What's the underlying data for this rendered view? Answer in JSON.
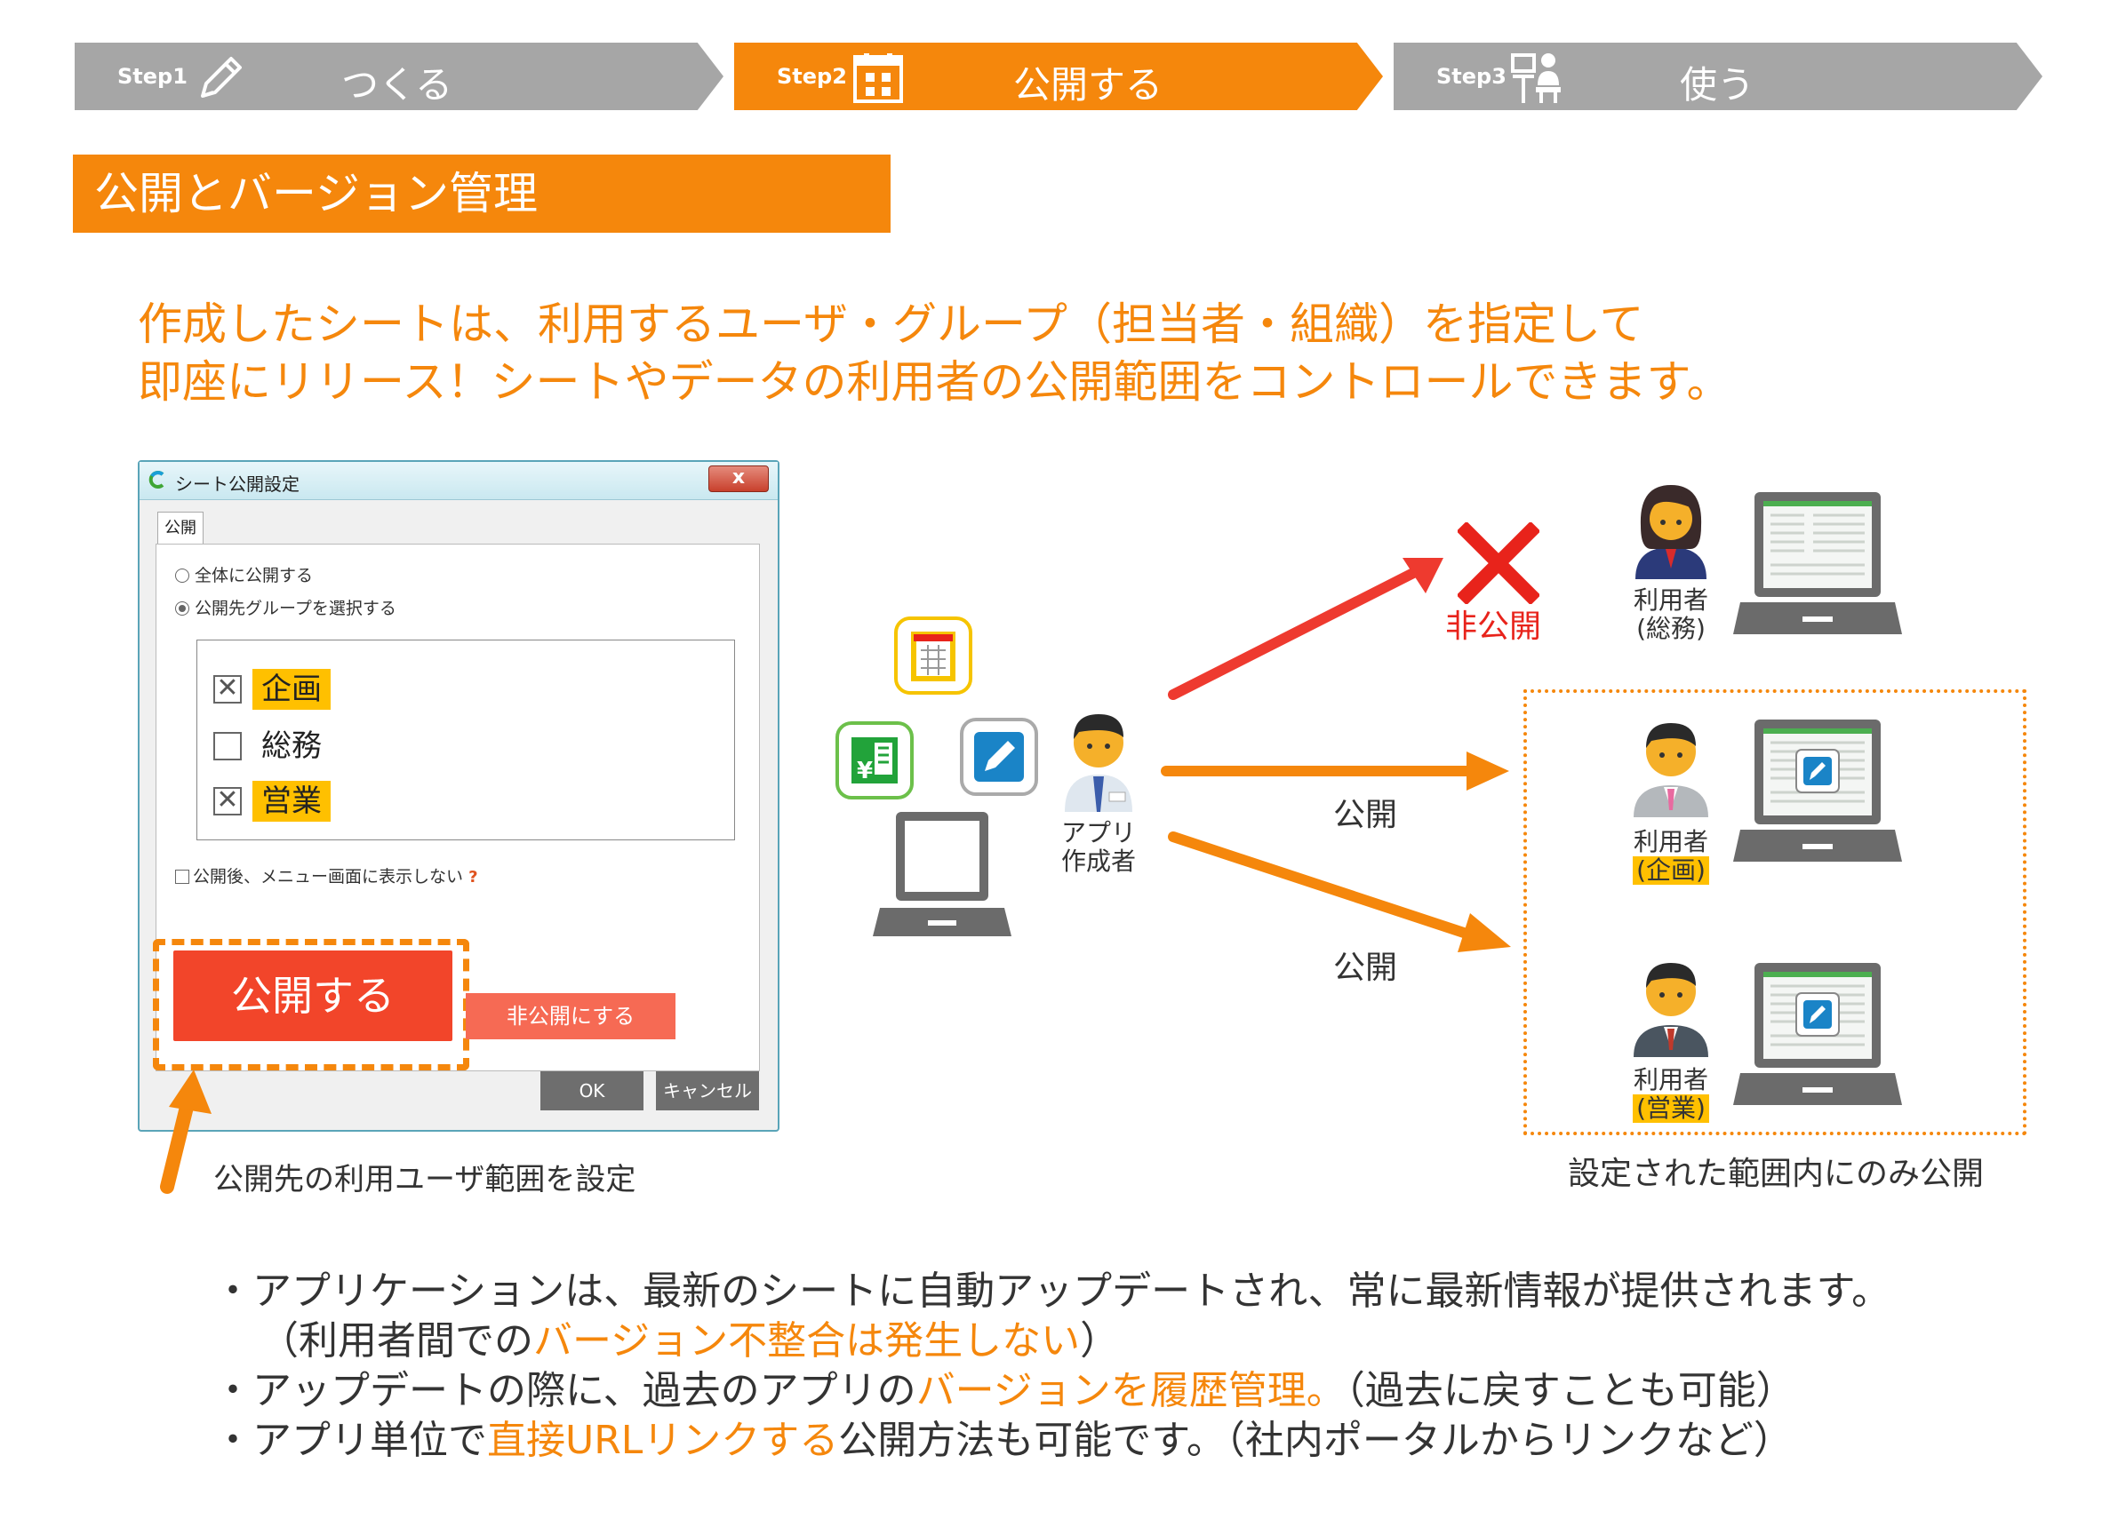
{
  "steps": [
    {
      "num": "Step1",
      "label": "つくる",
      "icon": "pencil-icon",
      "state": "inactive"
    },
    {
      "num": "Step2",
      "label": "公開する",
      "icon": "calendar-icon",
      "state": "active"
    },
    {
      "num": "Step3",
      "label": "使う",
      "icon": "users-icon",
      "state": "inactive"
    }
  ],
  "colors": {
    "accent": "#f5870c",
    "inactive": "#a6a6a6",
    "highlight": "#ffc000",
    "red": "#e8231b"
  },
  "section_title": "公開とバージョン管理",
  "lead": {
    "line1": "作成したシートは、利用するユーザ・グループ（担当者・組織）を指定して",
    "line2": "即座にリリース！シートやデータの利用者の公開範囲をコントロールできます。"
  },
  "dialog": {
    "title": "シート公開設定",
    "close": "x",
    "tab": "公開",
    "radio_all": "全体に公開する",
    "radio_group": "公開先グループを選択する",
    "groups": [
      {
        "label": "企画",
        "checked": true,
        "highlight": true
      },
      {
        "label": "総務",
        "checked": false,
        "highlight": false
      },
      {
        "label": "営業",
        "checked": true,
        "highlight": true
      }
    ],
    "hide_menu": "公開後、メニュー画面に表示しない",
    "publish_button": "公開する",
    "unpublish_button": "非公開にする",
    "ok_button": "OK",
    "cancel_button": "キャンセル"
  },
  "dialog_caption": "公開先の利用ユーザ範囲を設定",
  "creator_label": {
    "line1": "アプリ",
    "line2": "作成者"
  },
  "unpublished_label": "非公開",
  "published_label_1": "公開",
  "published_label_2": "公開",
  "users": [
    {
      "role": "利用者",
      "dept": "(総務)",
      "highlight": false
    },
    {
      "role": "利用者",
      "dept": "(企画)",
      "highlight": true
    },
    {
      "role": "利用者",
      "dept": "(営業)",
      "highlight": true
    }
  ],
  "scope_caption": "設定された範囲内にのみ公開",
  "bullets": {
    "b1": "・アプリケーションは、最新のシートに自動アップデートされ、常に最新情報が提供されます。",
    "b2_pre": "（利用者間での",
    "b2_hl": "バージョン不整合は発生しない",
    "b2_post": "）",
    "b3_pre": "・アップデートの際に、過去のアプリの",
    "b3_hl": "バージョンを履歴管理。",
    "b3_post": "（過去に戻すことも可能）",
    "b4_pre": "・アプリ単位で",
    "b4_hl": "直接URLリンクする",
    "b4_post": "公開方法も可能です。（社内ポータルからリンクなど）"
  }
}
